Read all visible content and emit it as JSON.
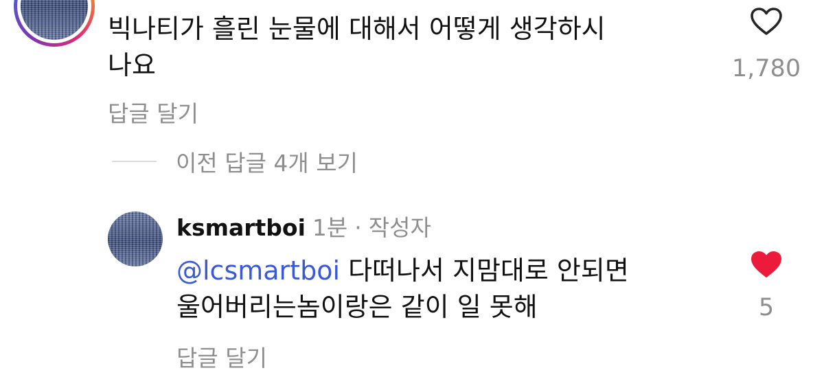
{
  "top_comment": {
    "text_line1": "빅나티가 흘린 눈물에 대해서 어떻게 생각하시",
    "text_line2": "나요",
    "reply_label": "답글 달기",
    "likes": "1,780",
    "liked": false
  },
  "view_previous_label": "이전 답글 4개 보기",
  "reply_comment": {
    "username": "ksmartboi",
    "time": "1분",
    "separator": "·",
    "author_badge": "작성자",
    "mention": "@lcsmartboi",
    "text_line1": " 다떠나서 지맘대로 안되면",
    "text_line2": "울어버리는놈이랑은 같이 일 못해",
    "reply_label": "답글 달기",
    "likes": "5",
    "liked": true
  },
  "icons": {
    "top_like": "heart-outline-icon",
    "reply_like": "heart-filled-icon"
  },
  "colors": {
    "secondary_text": "#8e8e8e",
    "mention": "#3959d9",
    "like_active": "#ed1b3b"
  }
}
